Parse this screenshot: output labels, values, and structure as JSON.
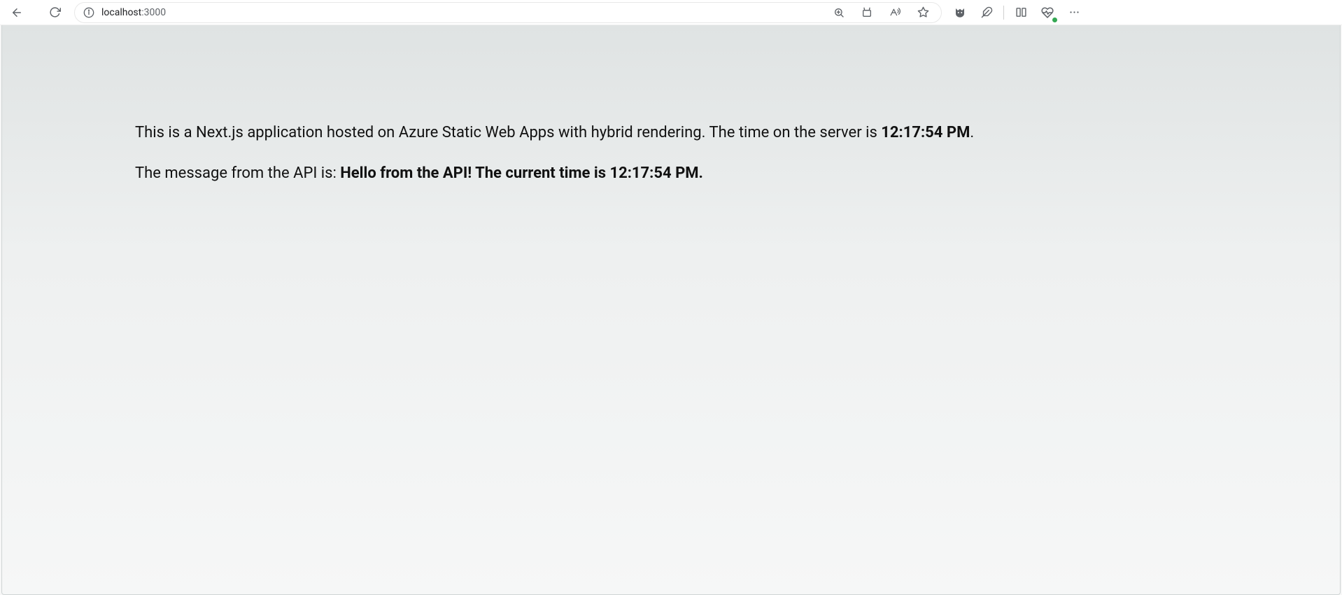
{
  "browser": {
    "url_host": "localhost",
    "url_port": ":3000"
  },
  "page": {
    "line1_prefix": "This is a Next.js application hosted on Azure Static Web Apps with hybrid rendering. The time on the server is ",
    "server_time": "12:17:54 PM",
    "line1_suffix": ".",
    "line2_prefix": "The message from the API is: ",
    "api_message": "Hello from the API! The current time is 12:17:54 PM."
  }
}
